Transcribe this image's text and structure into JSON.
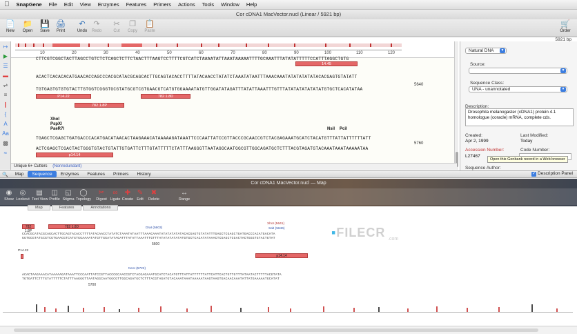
{
  "menubar": {
    "app": "SnapGene",
    "items": [
      "File",
      "Edit",
      "View",
      "Enzymes",
      "Features",
      "Primers",
      "Actions",
      "Tools",
      "Window",
      "Help"
    ]
  },
  "window": {
    "title": "Cor cDNA1 MacVector.nucl (Linear / 5921 bp)"
  },
  "toolbar": {
    "new": "New",
    "open": "Open",
    "save": "Save",
    "print": "Print",
    "undo": "Undo",
    "redo": "Redo",
    "cut": "Cut",
    "copy": "Copy",
    "paste": "Paste",
    "order": "Order"
  },
  "length_label": "5921 bp",
  "sequence": {
    "ruler_ticks": [
      "10",
      "20",
      "30",
      "40",
      "50",
      "60",
      "70",
      "80",
      "90",
      "100",
      "110",
      "120"
    ],
    "row0_top": "CTTCGTCGGCTACTTAGCCTGTCTCTCAGCTCTTCTAACTTTAAGTCCTTTTCGTCATCTAAAATATTAAATAAAAATTTTGCAAATTTATATATTTTTCCATTTAGGCTGTG",
    "row1_top": "ACACTCACACACATGAACACCAGCCCACGCATACGCAGCACTTGCAGTACACCTTTTATACAACCTATATCTAAATATAATTTAAACAAATATATATATATACACGAGTGTATATT",
    "row1_bottom": "TGTGAGTGTGTGTACTTGTGGTCGGGTGCGTATGCGTCGTGAACGTCATGTGGAAAATATGTTGGATATAGATTTATATTAAATTTGTTTATATATATATATATGTGCTCACATATAA",
    "row1_pos": "5640",
    "row2_top": "TGAGCTCGAGCTGATGACCCACATGACATAACACTAAGAAACATAAAAAGATAAATTCCCAATTATCCGTTACCCGCAACCGTCTACGAGAAATGCATCTACATGTTTATTATTTTTTATT",
    "row2_bottom": "ACTCGAGCTCGACTACTGGGTGTACTGTATTGTGATTCTTTGTATTTTTCTATTTAAGGGTTAATAGGCAATGGCGTTGGCAGATGCTCTTTACGTAGATGTACAAATAAATAAAAATAA",
    "row2_pos": "5760",
    "features": {
      "f1445": "14.45",
      "p1422": "P14.22",
      "f782a": "782 1.8P",
      "f782b": "782 1.8D",
      "p1414": "p14.14"
    },
    "enzymes": {
      "xhoi": "XhoI",
      "pspxi": "PspXI",
      "paer7i": "PaeR7I",
      "nsii": "NsiI",
      "pcii": "PciI"
    },
    "subtab_cutters": "Unique 6+ Cutters",
    "subtab_nonredundant": "(Nonredundant)"
  },
  "info_panel": {
    "type_select": "Natural DNA",
    "source_label": "Source:",
    "source_value": "",
    "seqclass_label": "Sequence Class:",
    "seqclass_value": "UNA - unannotated",
    "description_label": "Description:",
    "description_value": "Drosophila melanogaster (cDNA1) protein 4.1 homologue (coracle) mRNA, complete cds.",
    "created_label": "Created:",
    "created_value": "Apr 2, 1999",
    "modified_label": "Last Modified:",
    "modified_value": "Today",
    "accession_label": "Accession Number:",
    "accession_value": "L27467",
    "code_label": "Code Number:",
    "author_label": "Sequence Author:",
    "tooltip": "Open this Genbank record in a Web browser"
  },
  "tabs": [
    "Map",
    "Sequence",
    "Enzymes",
    "Features",
    "Primers",
    "History"
  ],
  "active_tab": "Sequence",
  "description_panel": "Description Panel",
  "second_window": {
    "title": "Cor cDNA1 MacVector.nucl — Map",
    "toolbar": [
      "Show",
      "Lookout",
      "Text View",
      "Profile",
      "Stigma",
      "Topology",
      "Digest",
      "Ligate",
      "Create",
      "Edit",
      "Delete",
      "Range"
    ],
    "tabs": [
      "Map",
      "Features",
      "Annotations"
    ],
    "row1_seq_top": "CCACGCATACGCAGCACTTGCAGTACACCTTTTATACAACCTATATCTAAATATAATTTAAACAAATATATATATATACACGAGTGTATATTTGAGCTCGAGCTGATGACCCACATGACATA",
    "row1_seq_bottom": "GGTGCGTATGCGTCGTGAACGTCATGTGGAAAATATGTTGGATATAGATTTATATTAAATTTGTTTATATATATATATGTGCTCACATATAAACTCGAGCTCGACTACTGGGTGTACTGTAT",
    "row1_pos": "5600",
    "row2_seq_top": "ACACTAAGAAACATAAAAAGATAAATTCCCAATTATCCGTTACCCGCAACCGTCTACGAGAAATGCATCTACATGTTTATTATTTTTTATTCATTCACTGTTGTTTATAATACTTTTTACGTATA",
    "row2_seq_bottom": "TGTGATTCTTTGTATTTTTCTATTTAAGGGTTAATAGGCAATGGCGTTGGCAGATGCTCTTTACGTAGATGTACAAATAAATAAAAATAAGTAAGTGACAACAAATATTATGAAAAATGCATAT",
    "row2_pos": "5700",
    "features": {
      "a": "782 1.8P",
      "b": "782 1.8D",
      "c": "P14.22",
      "d": "p14.14"
    },
    "enzymes": {
      "drai": "DraI (5603)",
      "xhoi": "XhoI (5641)",
      "sali": "SalI (5646)",
      "ncoi": "NcoI (5722)"
    }
  },
  "watermark": {
    "main": "FILECR",
    "sub": ".com"
  },
  "colors": {
    "feature": "#e46767",
    "accent": "#3b7de0",
    "enzyme": "#2d4fa8"
  }
}
